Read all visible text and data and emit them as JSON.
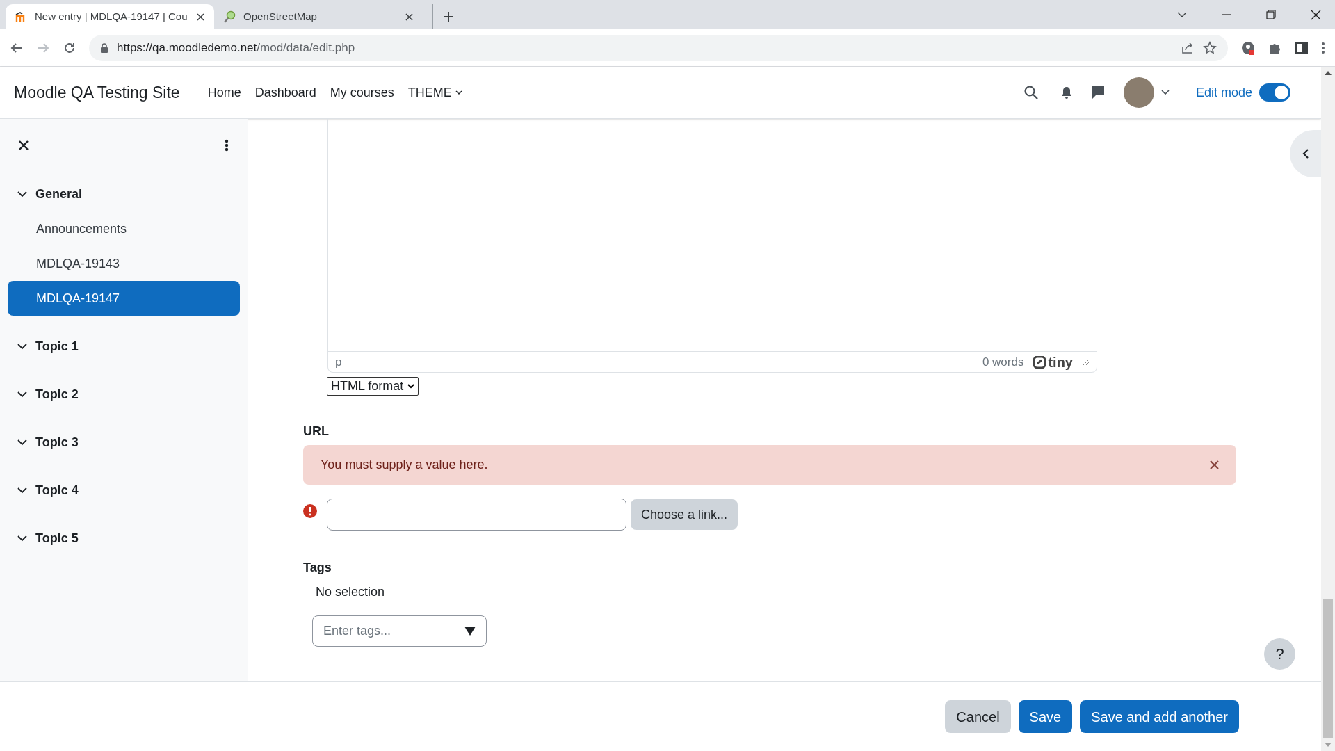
{
  "browser": {
    "tabs": [
      {
        "title": "New entry | MDLQA-19147 | Cou",
        "selected": true
      },
      {
        "title": "OpenStreetMap",
        "selected": false
      }
    ],
    "url_host": "https://qa.moodledemo.net",
    "url_path": "/mod/data/edit.php"
  },
  "navbar": {
    "site_name": "Moodle QA Testing Site",
    "items": [
      {
        "label": "Home",
        "kind": "link"
      },
      {
        "label": "Dashboard",
        "kind": "link"
      },
      {
        "label": "My courses",
        "kind": "link"
      },
      {
        "label": "THEME",
        "kind": "menu"
      }
    ],
    "edit_mode": {
      "label": "Edit mode",
      "on": true
    }
  },
  "sidebar": {
    "items": [
      {
        "label": "General",
        "expanded": true,
        "children": [
          {
            "label": "Announcements",
            "selected": false
          },
          {
            "label": "MDLQA-19143",
            "selected": false
          },
          {
            "label": "MDLQA-19147",
            "selected": true
          }
        ]
      },
      {
        "label": "Topic 1",
        "expanded": true
      },
      {
        "label": "Topic 2",
        "expanded": true
      },
      {
        "label": "Topic 3",
        "expanded": true
      },
      {
        "label": "Topic 4",
        "expanded": true
      },
      {
        "label": "Topic 5",
        "expanded": true
      }
    ]
  },
  "editor": {
    "path": "p",
    "word_count": "0 words",
    "brand": "tiny",
    "format": "HTML format"
  },
  "url_field": {
    "label": "URL",
    "error": "You must supply a value here.",
    "button": "Choose a link..."
  },
  "tags_field": {
    "label": "Tags",
    "selection": "No selection",
    "placeholder": "Enter tags..."
  },
  "help": "?",
  "footer_buttons": [
    {
      "label": "Cancel",
      "kind": "secondary"
    },
    {
      "label": "Save",
      "kind": "primary"
    },
    {
      "label": "Save and add another",
      "kind": "primary"
    }
  ]
}
